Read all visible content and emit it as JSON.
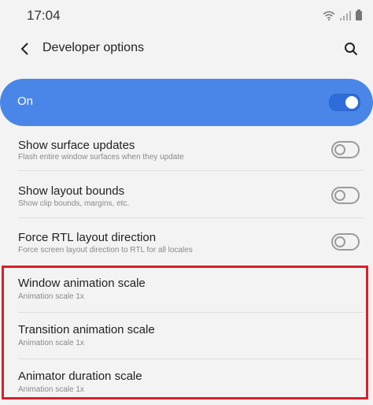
{
  "status": {
    "time": "17:04",
    "icons": [
      "wifi-icon",
      "signal-icon",
      "battery-icon"
    ]
  },
  "appbar": {
    "title": "Developer options"
  },
  "main_switch": {
    "label": "On",
    "state": true,
    "accent": "#4a86e8"
  },
  "settings": [
    {
      "title": "Show surface updates",
      "subtitle": "Flash entire window surfaces when they update",
      "toggle": false
    },
    {
      "title": "Show layout bounds",
      "subtitle": "Show clip bounds, margins, etc.",
      "toggle": false
    },
    {
      "title": "Force RTL layout direction",
      "subtitle": "Force screen layout direction to RTL for all locales",
      "toggle": false
    },
    {
      "title": "Window animation scale",
      "subtitle": "Animation scale 1x"
    },
    {
      "title": "Transition animation scale",
      "subtitle": "Animation scale 1x"
    },
    {
      "title": "Animator duration scale",
      "subtitle": "Animation scale 1x"
    }
  ],
  "highlight_color": "#d9202a"
}
